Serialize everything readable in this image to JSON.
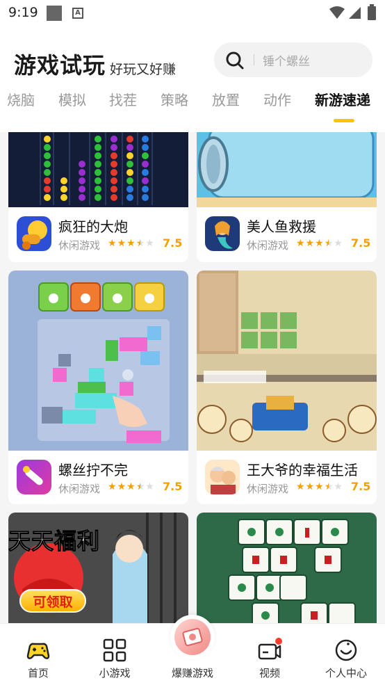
{
  "status": {
    "time": "9:19"
  },
  "header": {
    "title": "游戏试玩",
    "subtitle": "好玩又好赚",
    "search_placeholder": "锤个螺丝"
  },
  "tabs": [
    {
      "label": "烧脑",
      "active": false
    },
    {
      "label": "模拟",
      "active": false
    },
    {
      "label": "找茬",
      "active": false
    },
    {
      "label": "策略",
      "active": false
    },
    {
      "label": "放置",
      "active": false
    },
    {
      "label": "动作",
      "active": false
    },
    {
      "label": "新游速递",
      "active": true
    }
  ],
  "games": [
    {
      "name": "疯狂的大炮",
      "category": "休闲游戏",
      "rating": "7.5",
      "stars": 3.5,
      "icon": "cannon-app-icon"
    },
    {
      "name": "美人鱼救援",
      "category": "休闲游戏",
      "rating": "7.5",
      "stars": 3.5,
      "icon": "mermaid-app-icon"
    },
    {
      "name": "螺丝拧不完",
      "category": "休闲游戏",
      "rating": "7.5",
      "stars": 3.5,
      "icon": "screw-app-icon"
    },
    {
      "name": "王大爷的幸福生活",
      "category": "休闲游戏",
      "rating": "7.5",
      "stars": 3.5,
      "icon": "grandpa-app-icon"
    }
  ],
  "promo": {
    "banner_title": "天天福利",
    "banner_button": "可领取"
  },
  "bottom_nav": [
    {
      "label": "首页",
      "icon": "gamepad-icon"
    },
    {
      "label": "小游戏",
      "icon": "grid-icon"
    },
    {
      "label": "爆赚游戏",
      "icon": "money-icon"
    },
    {
      "label": "视频",
      "icon": "video-icon"
    },
    {
      "label": "个人中心",
      "icon": "smile-icon"
    }
  ],
  "colors": {
    "accent": "#ffc400",
    "rating": "#f5a000"
  }
}
